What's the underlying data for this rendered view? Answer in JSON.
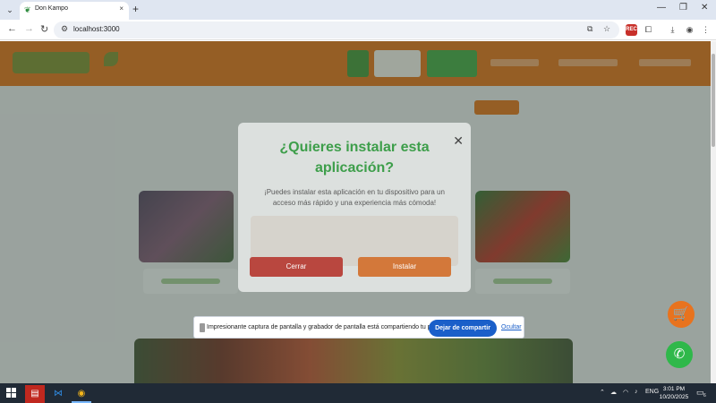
{
  "browser": {
    "tab_title": "Don Kampo",
    "tab_close": "×",
    "new_tab": "+",
    "url": "localhost:3000",
    "window_controls": [
      "—",
      "❐",
      "✕"
    ]
  },
  "modal": {
    "title": "¿Quieres instalar esta aplicación?",
    "text": "¡Puedes instalar esta aplicación en tu dispositivo para un acceso más rápido y una experiencia más cómoda!",
    "close_icon": "✕",
    "close_button": "Cerrar",
    "install_button": "Instalar"
  },
  "share_bar": {
    "message": "Impresionante captura de pantalla y grabador de pantalla está compartiendo tu pantalla.",
    "stop_button": "Dejar de compartir",
    "hide_link": "Ocultar"
  },
  "taskbar": {
    "tray_lang": "ENG",
    "time": "3:01 PM",
    "date": "10/20/2025",
    "notification_count": "6"
  },
  "colors": {
    "header": "#d6680e",
    "primary_green": "#3d9e4a",
    "close_red": "#b9473f",
    "install_orange": "#d3783a",
    "share_blue": "#1a5fc9"
  }
}
